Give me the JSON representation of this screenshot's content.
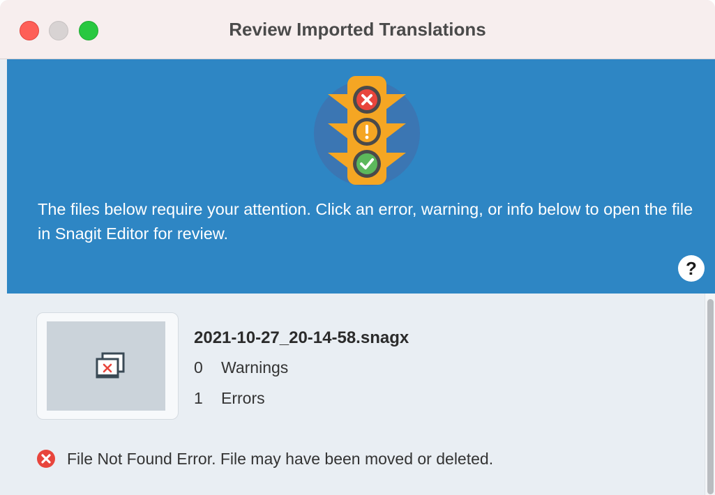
{
  "window": {
    "title": "Review Imported Translations"
  },
  "header": {
    "message": "The files below require your attention. Click an error, warning, or info below to open the file in Snagit Editor for review.",
    "help_label": "?",
    "background_color": "#2e86c4",
    "icon": "traffic-light-icon"
  },
  "file": {
    "name": "2021-10-27_20-14-58.snagx",
    "warnings_count": "0",
    "warnings_label": "Warnings",
    "errors_count": "1",
    "errors_label": "Errors",
    "thumbnail_icon": "missing-file-icon"
  },
  "errors": [
    {
      "icon": "error-x-icon",
      "message": "File Not Found Error. File may have been moved or deleted."
    }
  ],
  "colors": {
    "error_red": "#e8453c",
    "warning_orange": "#f5a623",
    "success_green": "#5cb85c"
  }
}
